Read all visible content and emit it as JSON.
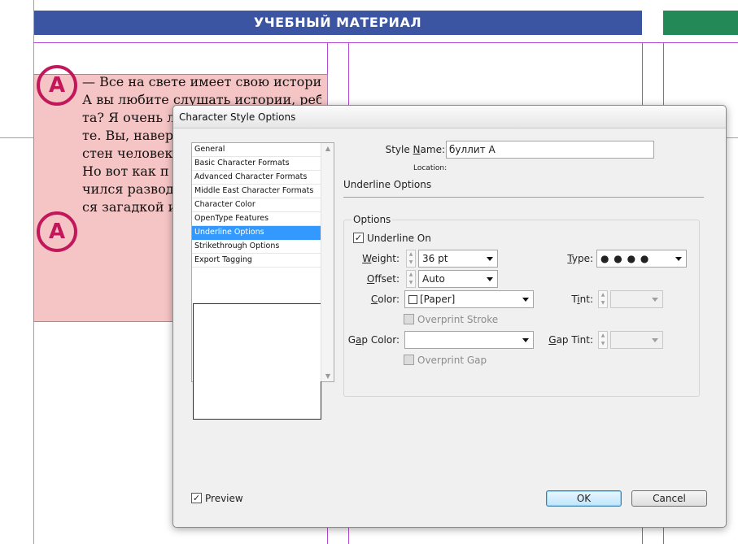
{
  "document": {
    "header_title": "УЧЕБНЫЙ МАТЕРИАЛ",
    "bullet_letter": "A",
    "text_lines": [
      "— Все на свете имеет свою историю.",
      "А вы любите слушать истории, ребя-",
      "та? Я очень л",
      "те. Вы, навер",
      "стен человеку",
      "Но вот как п",
      "чился разводи",
      "ся загадкой и"
    ]
  },
  "dialog": {
    "title": "Character Style Options",
    "categories": [
      "General",
      "Basic Character Formats",
      "Advanced Character Formats",
      "Middle East Character Formats",
      "Character Color",
      "OpenType Features",
      "Underline Options",
      "Strikethrough Options",
      "Export Tagging"
    ],
    "selected_category": "Underline Options",
    "style_name_label": "Style Name:",
    "style_name_value": "буллит А",
    "location_label": "Location:",
    "section_title": "Underline Options",
    "group_title": "Options",
    "underline_on_label": "Underline On",
    "underline_on_checked": true,
    "weight_label": "Weight:",
    "weight_value": "36 pt",
    "type_label": "Type:",
    "type_value": "● ● ● ●",
    "offset_label": "Offset:",
    "offset_value": "Auto",
    "color_label": "Color:",
    "color_value": "[Paper]",
    "tint_label": "Tint:",
    "tint_value": "",
    "overprint_stroke_label": "Overprint Stroke",
    "gap_color_label": "Gap Color:",
    "gap_color_value": "",
    "gap_tint_label": "Gap Tint:",
    "gap_tint_value": "",
    "overprint_gap_label": "Overprint Gap",
    "preview_label": "Preview",
    "preview_checked": true,
    "ok_label": "OK",
    "cancel_label": "Cancel"
  },
  "colors": {
    "header_blue": "#3b55a2",
    "header_green": "#238a57",
    "frame_pink": "#f5c5c5",
    "bullet_magenta": "#c2185b",
    "selection_blue": "#3399ff"
  }
}
